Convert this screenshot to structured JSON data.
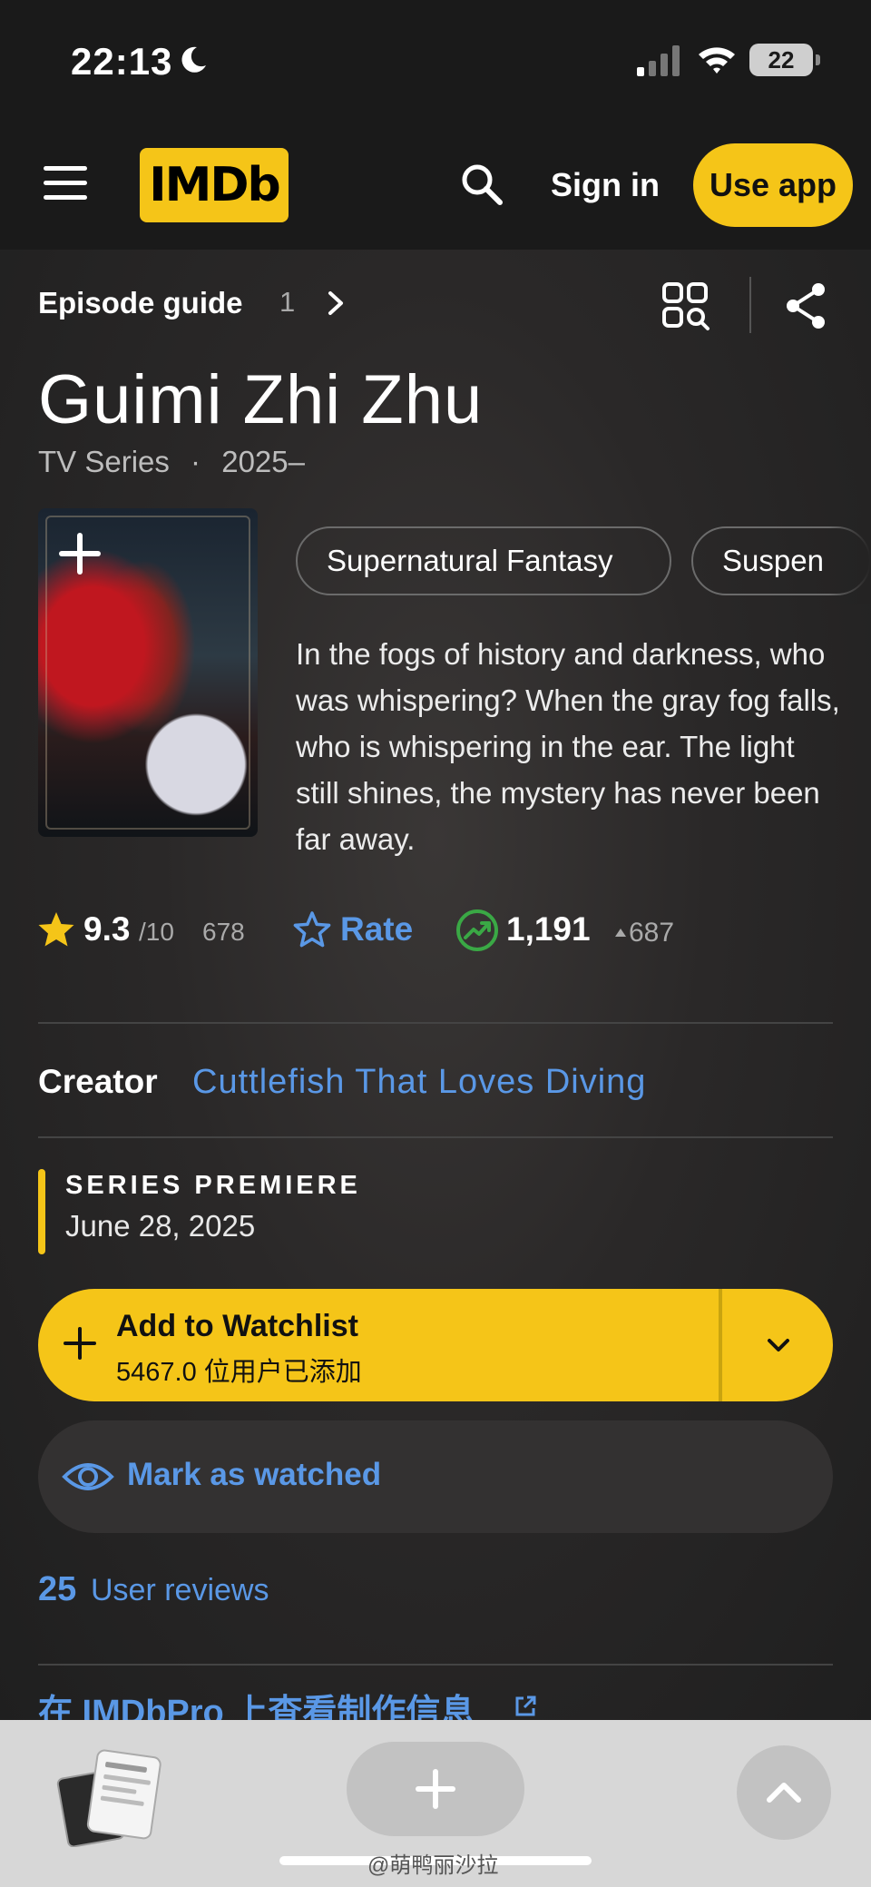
{
  "status": {
    "time": "22:13",
    "battery": "22"
  },
  "nav": {
    "logo": "IMDb",
    "sign_in": "Sign in",
    "use_app": "Use app"
  },
  "breadcrumb": {
    "label": "Episode guide",
    "count": "1"
  },
  "title": {
    "name": "Guimi Zhi Zhu",
    "type": "TV Series",
    "separator": "·",
    "years": "2025–"
  },
  "genres": [
    "Supernatural Fantasy",
    "Suspen"
  ],
  "description": "In the fogs of history and darkness, who was whispering? When the gray fog falls, who is whispering in the ear. The light still shines, the mystery has never been far away.",
  "ratings": {
    "score": "9.3",
    "scale": "/10",
    "count": "678",
    "rate_label": "Rate",
    "popularity": "1,191",
    "popularity_delta": "687"
  },
  "creator": {
    "label": "Creator",
    "name": "Cuttlefish That Loves Diving"
  },
  "premiere": {
    "label": "SERIES PREMIERE",
    "date": "June 28, 2025"
  },
  "watchlist": {
    "title": "Add to Watchlist",
    "subtitle": "5467.0 位用户已添加"
  },
  "watched": {
    "label": "Mark as watched"
  },
  "reviews": {
    "count": "25",
    "label": "User reviews"
  },
  "pro_link": "在 IMDbPro 上查看制作信息",
  "watermark": "@萌鸭丽沙拉",
  "colors": {
    "accent": "#f5c518",
    "link": "#5a98e6",
    "background": "#1f1f1f",
    "trending": "#3aa845"
  },
  "icons": [
    "moon-icon",
    "signal-icon",
    "wifi-icon",
    "menu-icon",
    "search-icon",
    "chevron-right-icon",
    "grid-search-icon",
    "share-icon",
    "plus-icon",
    "star-icon",
    "star-outline-icon",
    "trending-up-icon",
    "chevron-down-icon",
    "eye-icon",
    "external-link-icon",
    "chevron-up-icon"
  ]
}
